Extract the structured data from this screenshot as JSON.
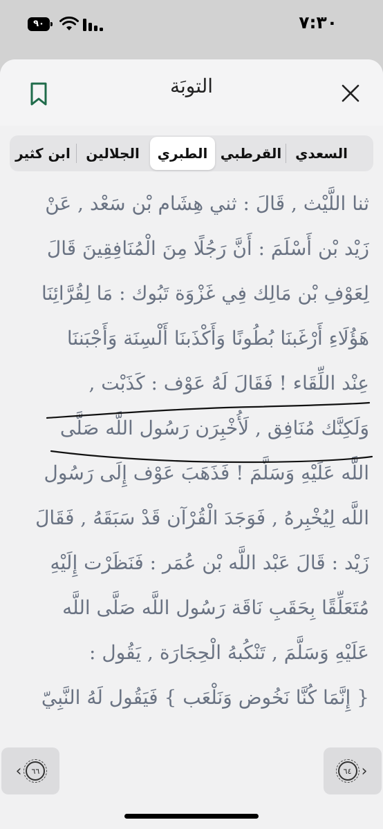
{
  "status_bar": {
    "time": "٧:٣٠",
    "battery": "٩٠"
  },
  "header": {
    "title": "التوبَة"
  },
  "tabs": [
    {
      "label": "ابن كثير",
      "active": false
    },
    {
      "label": "الجلالين",
      "active": false
    },
    {
      "label": "الطبري",
      "active": true
    },
    {
      "label": "القرطبي",
      "active": false
    },
    {
      "label": "السعدي",
      "active": false
    }
  ],
  "tafsir": {
    "lines": [
      "ثنا اللَّيْث , قَالَ : ثني هِشَام بْن سَعْد , عَنْ",
      "زَيْد بْن أَسْلَمَ : أَنَّ رَجُلًا مِنَ الْمُنَافِقِينَ قَالَ",
      "لِعَوْفِ بْن مَالِك فِي غَزْوَة تَبُوك : مَا لِقُرَّائِنَا",
      "هَؤُلَاءِ أَرْغَبنَا بُطُونًا وَأَكْذَبنَا أَلْسِنَة وَأَجْبَننَا",
      "عِنْد اللِّقَاء ! فَقَالَ لَهُ عَوْف : كَذَبْت ,",
      "وَلَكِنَّك مُنَافِق , لَأُخْبِرَن رَسُول اللَّه صَلَّى",
      "اللَّه عَلَيْهِ وَسَلَّمَ ! فَذَهَبَ عَوْف إِلَى رَسُول",
      "اللَّه لِيُخْبِرهُ , فَوَجَدَ الْقُرْآن قَدْ سَبَقَهُ , فَقَالَ",
      "زَيْد : قَالَ عَبْد اللَّه بْن عُمَر : فَنَظَرْت إِلَيْهِ",
      "مُتَعَلِّقًا بِحَقَبِ نَاقَة رَسُول اللَّه صَلَّى اللَّه",
      "عَلَيْهِ وَسَلَّمَ , تَنْكُبهُ الْحِجَارَة , يَقُول :",
      "{ إِنَّمَا كُنَّا نَخُوض وَنَلْعَب } فَيَقُول لَهُ النَّبِيّ"
    ]
  },
  "nav": {
    "prev_ayah": "٦٦",
    "next_ayah": "٦٤"
  },
  "colors": {
    "text": "#6a7383",
    "bookmark": "#1f6b4a"
  }
}
